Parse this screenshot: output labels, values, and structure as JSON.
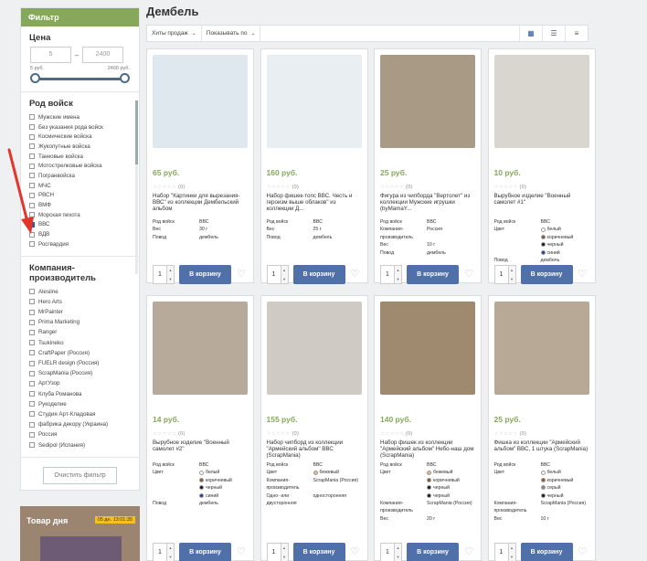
{
  "filter": {
    "header": "Фильтр",
    "price": {
      "title": "Цена",
      "min_placeholder": "5",
      "max_placeholder": "2400",
      "min_hint": "5 руб.",
      "max_hint": "2400 руб."
    },
    "troops": {
      "title": "Род войск",
      "items": [
        {
          "label": "Мужские имена",
          "checked": false
        },
        {
          "label": "Без указания рода войск",
          "checked": false
        },
        {
          "label": "Космические войска",
          "checked": false
        },
        {
          "label": "Жукопутные войска",
          "checked": false
        },
        {
          "label": "Танковые войска",
          "checked": false
        },
        {
          "label": "Мотострелковые войска",
          "checked": false
        },
        {
          "label": "Погранвойска",
          "checked": false
        },
        {
          "label": "МЧС",
          "checked": false
        },
        {
          "label": "РВСН",
          "checked": false
        },
        {
          "label": "ВМФ",
          "checked": false
        },
        {
          "label": "Морская пехота",
          "checked": false
        },
        {
          "label": "ВВС",
          "checked": true
        },
        {
          "label": "ВДВ",
          "checked": false
        },
        {
          "label": "Росгвардия",
          "checked": false
        }
      ]
    },
    "companies": {
      "title": "Компания-производитель",
      "items": [
        {
          "label": "Alesiine",
          "checked": false
        },
        {
          "label": "Hero Arts",
          "checked": false
        },
        {
          "label": "MrPainter",
          "checked": false
        },
        {
          "label": "Prima Marketing",
          "checked": false
        },
        {
          "label": "Ranger",
          "checked": false
        },
        {
          "label": "Tsukineko",
          "checked": false
        },
        {
          "label": "CraftPaper (Россия)",
          "checked": false
        },
        {
          "label": "FUELR design (Россия)",
          "checked": false
        },
        {
          "label": "ScrapMania (Россия)",
          "checked": false
        },
        {
          "label": "АртУзор",
          "checked": false
        },
        {
          "label": "Клуба Романова",
          "checked": false
        },
        {
          "label": "Рукоделие",
          "checked": false
        },
        {
          "label": "Студия Арт-Кладовая",
          "checked": false
        },
        {
          "label": "фабрика декору (Украина)",
          "checked": false
        },
        {
          "label": "Россия",
          "checked": false
        },
        {
          "label": "Sedipol (Испания)",
          "checked": false
        }
      ]
    },
    "clear_label": "Очистить фильтр"
  },
  "product_of_day": {
    "title": "Товар дня",
    "timer": "05 дн. 13:01:35"
  },
  "main": {
    "title": "Дембель",
    "sort_label": "Хиты продаж",
    "show_label": "Показывать по",
    "view_icons": [
      "grid-view-icon",
      "list-view-icon",
      "table-view-icon"
    ]
  },
  "ui": {
    "cart_label": "В корзину",
    "qty_default": "1",
    "stars": "☆☆☆☆☆",
    "reviews": "(0)"
  },
  "products": [
    {
      "price": "65 руб.",
      "name": "Набор \"Картинки для вырезания-ВВС\" из коллекции Дембельский альбом",
      "img": "#dfe7ef",
      "props": [
        [
          "Род войск",
          "ВВС"
        ],
        [
          "Вес",
          "30 г"
        ],
        [
          "Повод",
          "дембель"
        ]
      ]
    },
    {
      "price": "160 руб.",
      "name": "Набор фишек-топс ВВС. Честь и героизм выше облаков\" из коллекции Д...",
      "img": "#e8eef2",
      "props": [
        [
          "Род войск",
          "ВВС"
        ],
        [
          "Вес",
          "25 г"
        ],
        [
          "Повод",
          "дембель"
        ]
      ]
    },
    {
      "price": "25 руб.",
      "name": "Фигура из чипборда \"Вертолет\" из коллекции Мужские игрушки (byMamaY...",
      "img": "#a89a84",
      "props": [
        [
          "Род войск",
          "ВВС"
        ],
        [
          "Компания-производитель",
          "Россия"
        ],
        [
          "Вес",
          "10 г"
        ],
        [
          "Повод",
          "дембель"
        ]
      ]
    },
    {
      "price": "10 руб.",
      "name": "Вырубное изделие \"Военный самолет #1\"",
      "img": "#d9d6cf",
      "props": [
        [
          "Род войск",
          "ВВС"
        ],
        [
          "Цвет",
          "белый|коричневый|черный|синий"
        ],
        [
          "Повод",
          "дембель"
        ]
      ]
    },
    {
      "price": "14 руб.",
      "name": "Вырубное изделие \"Военный самолет #2\"",
      "img": "#b7aa9a",
      "props": [
        [
          "Род войск",
          "ВВС"
        ],
        [
          "Цвет",
          "белый|коричневый|черный|синий"
        ],
        [
          "Повод",
          "дембель"
        ]
      ]
    },
    {
      "price": "155 руб.",
      "name": "Набор чипборд из коллекции \"Армейский альбом\" ВВС (ScrapMania)",
      "img": "#cfcbc4",
      "props": [
        [
          "Род войск",
          "ВВС"
        ],
        [
          "Цвет",
          "бежевый"
        ],
        [
          "Компания-производитель",
          "ScrapMania (Россия)"
        ],
        [
          "Одно- или двусторонняя",
          "односторонняя"
        ]
      ]
    },
    {
      "price": "140 руб.",
      "name": "Набор фишек из коллекции \"Армейский альбом\" Небо-наш дом (ScrapMania)",
      "img": "#9f8a70",
      "props": [
        [
          "Род войск",
          "ВВС"
        ],
        [
          "Цвет",
          "бежевый|коричневый|черный|черный"
        ],
        [
          "Компания-производитель",
          "ScrapMania (Россия)"
        ],
        [
          "Вес",
          "20 г"
        ]
      ]
    },
    {
      "price": "25 руб.",
      "name": "Фишка из коллекции \"Армейский альбом\" ВВС, 1 штука (ScrapMania)",
      "img": "#b8a896",
      "props": [
        [
          "Род войск",
          "ВВС"
        ],
        [
          "Цвет",
          "белый|коричневый|серый|черный"
        ],
        [
          "Компания-производитель",
          "ScrapMania (Россия)"
        ],
        [
          "Вес",
          "10 г"
        ]
      ]
    }
  ],
  "colors": {
    "accent_green": "#86a85c",
    "button_blue": "#4f70a8",
    "annotation_red": "#e2352b"
  }
}
